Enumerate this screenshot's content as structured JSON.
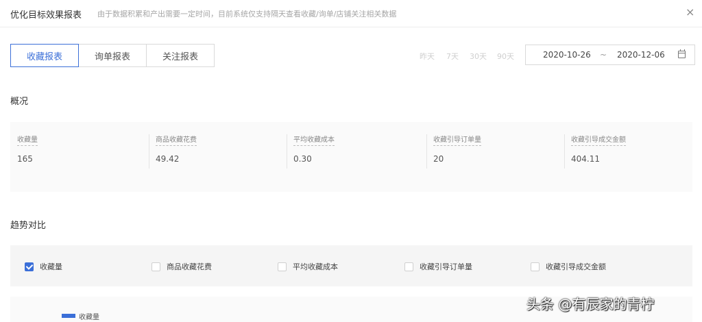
{
  "header": {
    "title": "优化目标效果报表",
    "subtitle": "由于数据积累和产出需要一定时间，目前系统仅支持隔天查看收藏/询单/店铺关注相关数据",
    "close": "×"
  },
  "tabs": [
    {
      "label": "收藏报表",
      "active": true
    },
    {
      "label": "询单报表",
      "active": false
    },
    {
      "label": "关注报表",
      "active": false
    }
  ],
  "quick_ranges": [
    "昨天",
    "7天",
    "30天",
    "90天"
  ],
  "date_range": {
    "start": "2020-10-26",
    "separator": "~",
    "end": "2020-12-06"
  },
  "overview": {
    "title": "概况",
    "metrics": [
      {
        "label": "收藏量",
        "value": "165"
      },
      {
        "label": "商品收藏花费",
        "value": "49.42"
      },
      {
        "label": "平均收藏成本",
        "value": "0.30"
      },
      {
        "label": "收藏引导订单量",
        "value": "20"
      },
      {
        "label": "收藏引导成交金额",
        "value": "404.11"
      }
    ]
  },
  "trend": {
    "title": "趋势对比",
    "options": [
      {
        "label": "收藏量",
        "checked": true
      },
      {
        "label": "商品收藏花费",
        "checked": false
      },
      {
        "label": "平均收藏成本",
        "checked": false
      },
      {
        "label": "收藏引导订单量",
        "checked": false
      },
      {
        "label": "收藏引导成交金额",
        "checked": false
      }
    ],
    "legend": "收藏量"
  },
  "watermark": "头条 @有辰家的青柠",
  "colors": {
    "accent": "#3b6fd8",
    "muted": "#a6a6a6"
  }
}
